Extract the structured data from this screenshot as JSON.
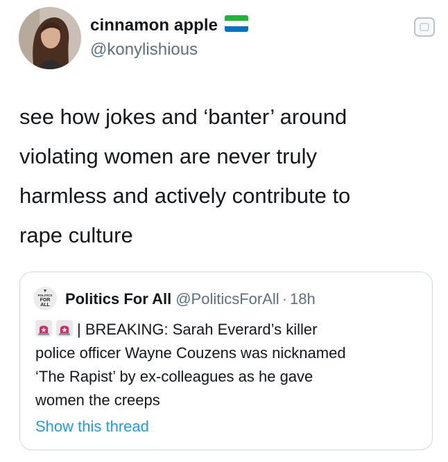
{
  "author": {
    "display_name": "cinnamon apple",
    "handle": "@konylishious",
    "flag": {
      "icon": "sierra-leone-flag-icon",
      "colors": [
        "#1eb53a",
        "#ffffff",
        "#0072c6"
      ]
    }
  },
  "tweet": {
    "lines": [
      "see how jokes and ‘banter’ around",
      "violating women are never truly",
      "harmless and actively contribute to",
      "rape culture"
    ]
  },
  "quote": {
    "avatar_text": {
      "line1": "POLITICS",
      "line2": "FOR",
      "line3": "ALL"
    },
    "display_name": "Politics For All",
    "handle": "@PoliticsForAll",
    "separator": "·",
    "time": "18h",
    "icons": [
      "siren-icon",
      "siren-icon"
    ],
    "lines": [
      "| BREAKING: Sarah Everard’s killer",
      "police officer Wayne Couzens was nicknamed",
      "‘The Rapist’ by ex-colleagues as he gave",
      "women the creeps"
    ],
    "show_thread": "Show this thread"
  },
  "colors": {
    "text": "#14171a",
    "secondary": "#5b7083",
    "link": "#1d9bf0",
    "border": "#cfd9de"
  }
}
